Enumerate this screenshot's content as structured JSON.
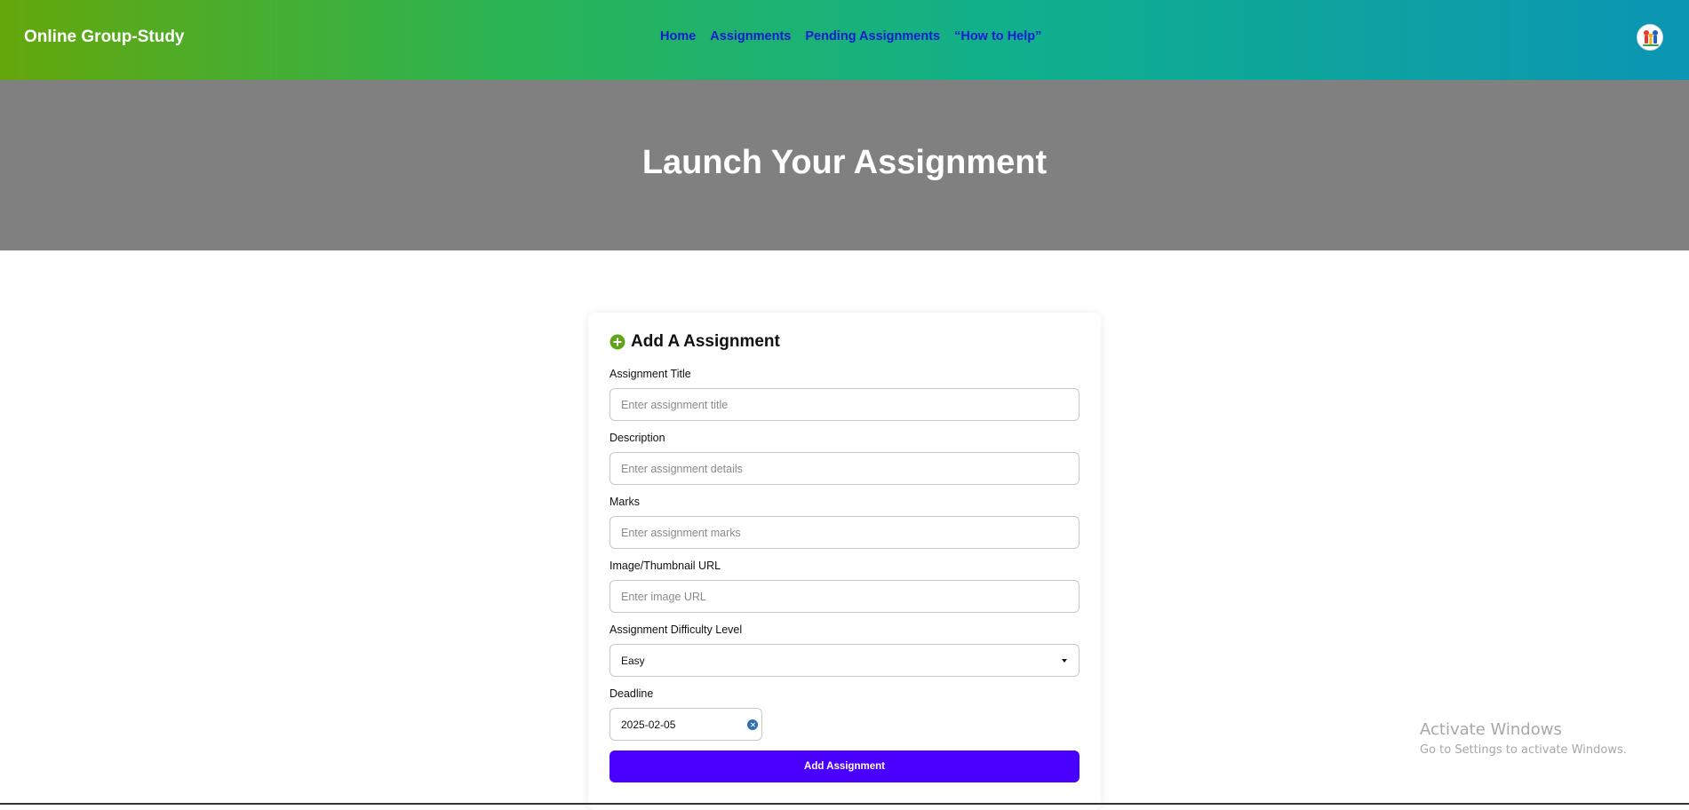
{
  "navbar": {
    "brand": "Online Group-Study",
    "links": [
      "Home",
      "Assignments",
      "Pending Assignments",
      "“How to Help”"
    ],
    "avatar_icon": "user-avatar"
  },
  "hero": {
    "title": "Launch Your Assignment"
  },
  "form": {
    "title": "Add A Assignment",
    "title_icon": "plus-circle-icon",
    "fields": {
      "title": {
        "label": "Assignment Title",
        "placeholder": "Enter assignment title",
        "value": ""
      },
      "description": {
        "label": "Description",
        "placeholder": "Enter assignment details",
        "value": ""
      },
      "marks": {
        "label": "Marks",
        "placeholder": "Enter assignment marks",
        "value": ""
      },
      "image_url": {
        "label": "Image/Thumbnail URL",
        "placeholder": "Enter image URL",
        "value": ""
      },
      "difficulty": {
        "label": "Assignment Difficulty Level",
        "selected": "Easy"
      },
      "deadline": {
        "label": "Deadline",
        "value": "2025-02-05"
      }
    },
    "submit_label": "Add Assignment"
  },
  "watermark": {
    "title": "Activate Windows",
    "subtitle": "Go to Settings to activate Windows."
  },
  "colors": {
    "gradient_start": "#64a70b",
    "gradient_end": "#0b95b4",
    "nav_link": "#0d1bd6",
    "hero_bg": "#808080",
    "accent_button": "#4a00ff",
    "plus_icon": "#5fa61d"
  }
}
